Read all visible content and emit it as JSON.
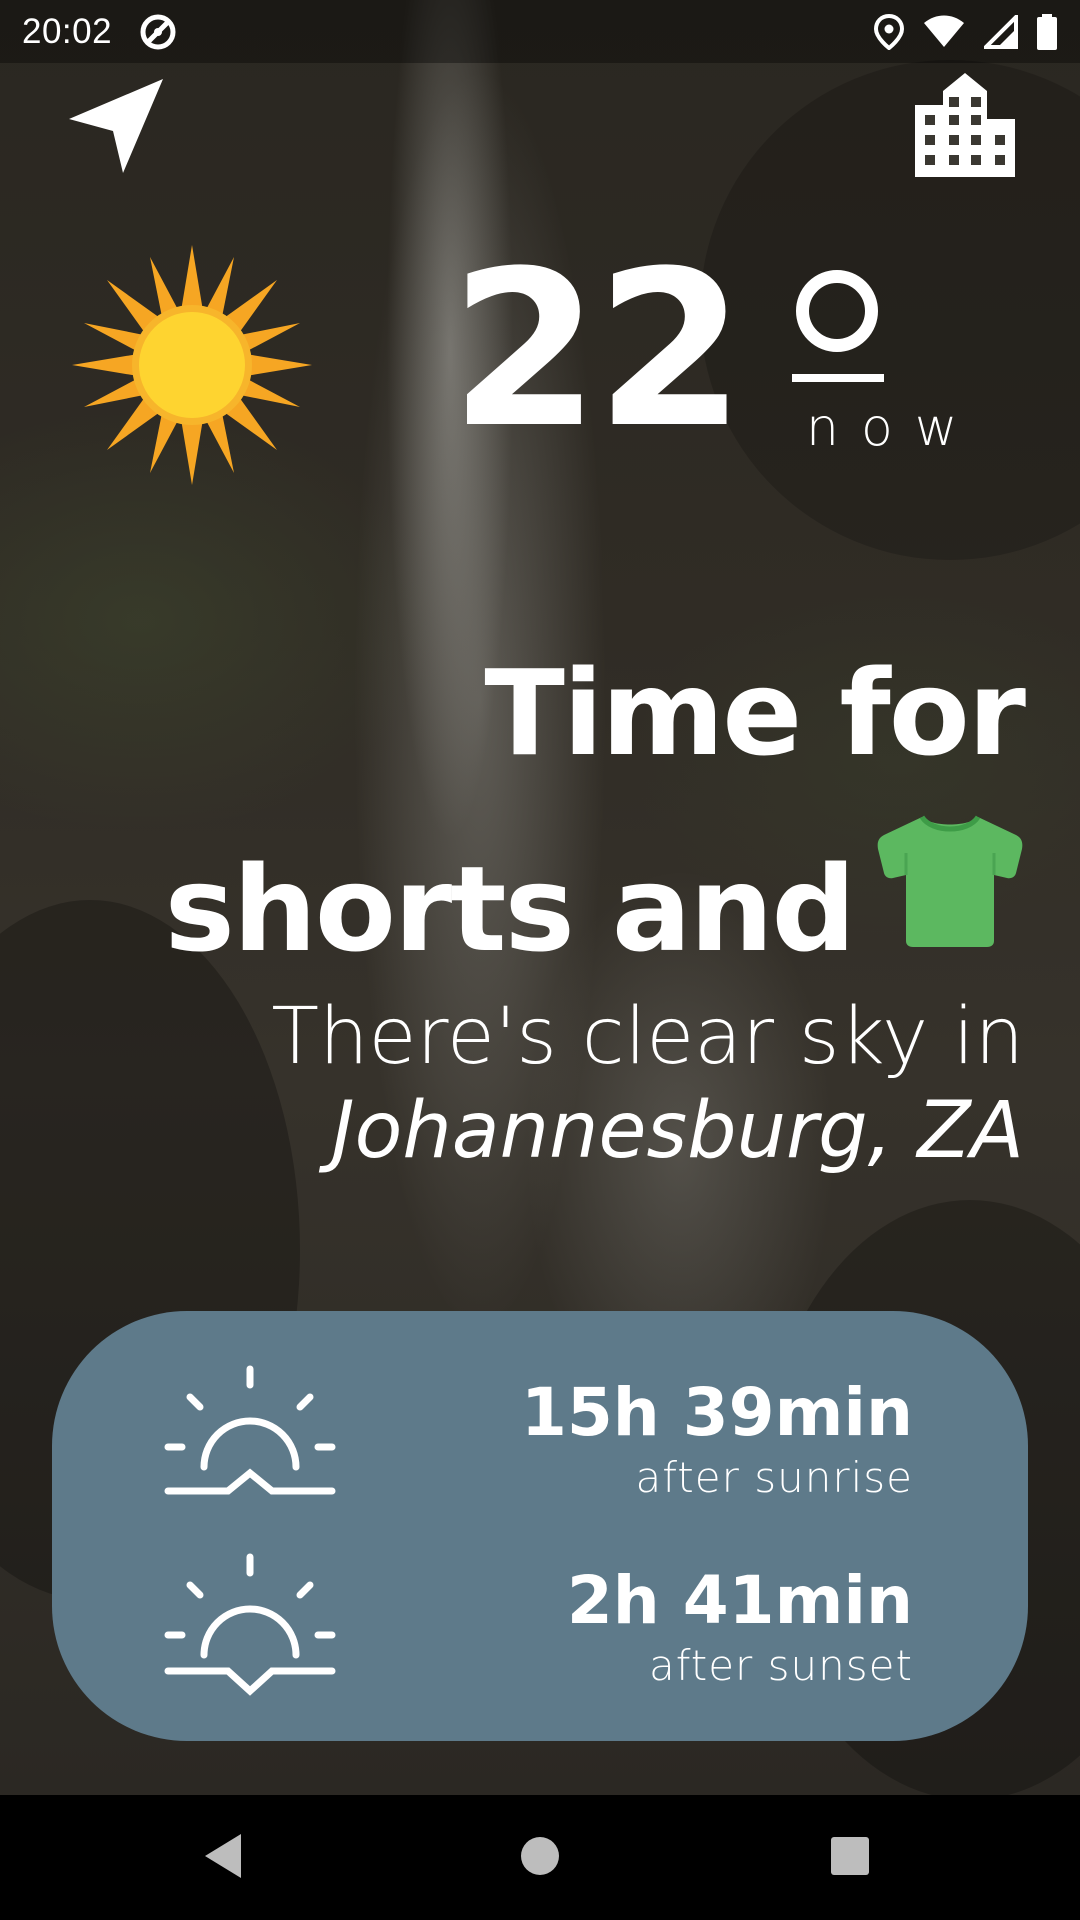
{
  "status_bar": {
    "time": "20:02",
    "icons": [
      "no-disturb-icon",
      "location-pin-icon",
      "wifi-icon",
      "cell-signal-icon",
      "battery-icon"
    ]
  },
  "top_actions": {
    "locate_icon": "navigation-arrow-icon",
    "city_icon": "city-buildings-icon"
  },
  "weather": {
    "icon": "sun-icon",
    "temperature": "22",
    "degree_symbol": "o",
    "time_label": "now"
  },
  "headline": {
    "line1": "Time for",
    "line2": "shorts and",
    "clothing_icon": "t-shirt-icon",
    "clothing_color": "#5cb860"
  },
  "condition": {
    "line": "There's clear sky in",
    "city": "Johannesburg, ZA"
  },
  "sun_card": {
    "background": "#5e7a8a",
    "rows": [
      {
        "icon": "sunrise-icon",
        "duration": "15h 39min",
        "label": "after sunrise"
      },
      {
        "icon": "sunset-icon",
        "duration": "2h 41min",
        "label": "after sunset"
      }
    ]
  },
  "nav_bar": {
    "buttons": [
      "back-icon",
      "home-icon",
      "recents-icon"
    ]
  }
}
